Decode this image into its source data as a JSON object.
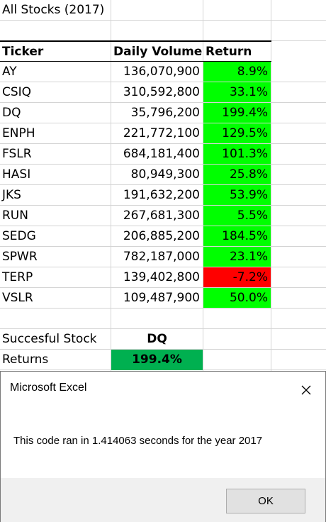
{
  "sheet": {
    "title": "All Stocks (2017)",
    "headers": {
      "ticker": "Ticker",
      "volume": "Daily Volume",
      "return": "Return"
    },
    "rows": [
      {
        "ticker": "AY",
        "volume": "136,070,900",
        "return": "8.9%",
        "status": "positive"
      },
      {
        "ticker": "CSIQ",
        "volume": "310,592,800",
        "return": "33.1%",
        "status": "positive"
      },
      {
        "ticker": "DQ",
        "volume": "35,796,200",
        "return": "199.4%",
        "status": "positive"
      },
      {
        "ticker": "ENPH",
        "volume": "221,772,100",
        "return": "129.5%",
        "status": "positive"
      },
      {
        "ticker": "FSLR",
        "volume": "684,181,400",
        "return": "101.3%",
        "status": "positive"
      },
      {
        "ticker": "HASI",
        "volume": "80,949,300",
        "return": "25.8%",
        "status": "positive"
      },
      {
        "ticker": "JKS",
        "volume": "191,632,200",
        "return": "53.9%",
        "status": "positive"
      },
      {
        "ticker": "RUN",
        "volume": "267,681,300",
        "return": "5.5%",
        "status": "positive"
      },
      {
        "ticker": "SEDG",
        "volume": "206,885,200",
        "return": "184.5%",
        "status": "positive"
      },
      {
        "ticker": "SPWR",
        "volume": "782,187,000",
        "return": "23.1%",
        "status": "positive"
      },
      {
        "ticker": "TERP",
        "volume": "139,402,800",
        "return": "-7.2%",
        "status": "negative"
      },
      {
        "ticker": "VSLR",
        "volume": "109,487,900",
        "return": "50.0%",
        "status": "positive"
      }
    ],
    "summary": {
      "successful_label": "Succesful Stock",
      "successful_value": "DQ",
      "returns_label": "Returns",
      "returns_value": "199.4%"
    },
    "colors": {
      "positive": "#00ff00",
      "negative": "#ff0000",
      "summary_fill": "#00b050"
    }
  },
  "dialog": {
    "title": "Microsoft Excel",
    "message": "This code ran in 1.414063 seconds for the year 2017",
    "ok_label": "OK",
    "close_icon": "close-icon"
  }
}
